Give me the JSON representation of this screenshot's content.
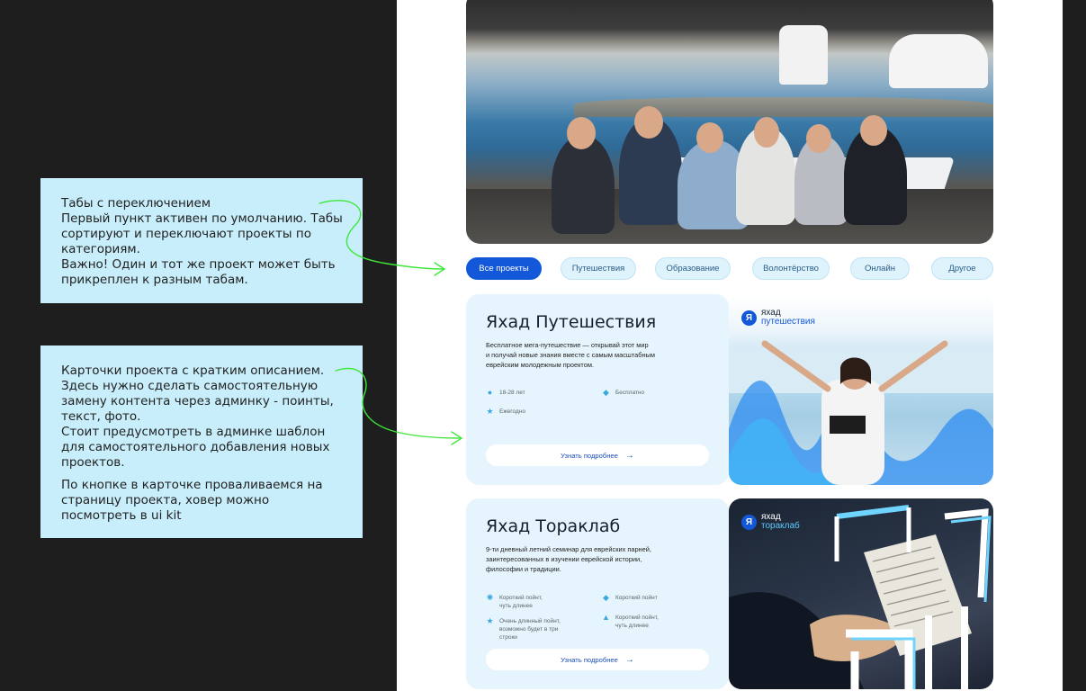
{
  "notes": [
    {
      "text": "Табы с переключением\nПервый пункт активен по умолчанию. Табы сортируют и переключают проекты по категориям.\nВажно! Один и тот же проект может быть прикреплен к разным табам."
    },
    {
      "text": "Карточки проекта с кратким описанием. Здесь нужно сделать самостоятельную замену контента через админку - поинты, текст, фото.\nСтоит предусмотреть в админке шаблон для самостоятельного добавления новых проектов.",
      "text2": "По кнопке в карточке проваливаемся на страницу проекта, ховер можно посмотреть в ui kit"
    }
  ],
  "tabs": [
    {
      "label": "Все проекты",
      "active": true
    },
    {
      "label": "Путешествия",
      "active": false
    },
    {
      "label": "Образование",
      "active": false
    },
    {
      "label": "Волонтёрство",
      "active": false
    },
    {
      "label": "Онлайн",
      "active": false
    },
    {
      "label": "Другое",
      "active": false
    }
  ],
  "cards": [
    {
      "title": "Яхад Путешествия",
      "description": "Бесплатное мега-путешествие — открывай этот мир\nи получай новые знания вместе с самым масштабным\nеврейским молодежным проектом.",
      "features": [
        {
          "icon": "person-icon",
          "text": "18-28 лет"
        },
        {
          "icon": "drop-icon",
          "text": "Бесплатно"
        },
        {
          "icon": "star-icon",
          "text": "Ежегодно"
        }
      ],
      "button": "Узнать подробнее",
      "brand": {
        "line1": "яхад",
        "line2": "путешествия",
        "mark": "Я"
      }
    },
    {
      "title": "Яхад Тораклаб",
      "description": "9-ти дневный летний семинар для еврейских парней,\nзаинтересованных в изучении еврейской истории,\nфилософии и традиции.",
      "features": [
        {
          "icon": "sun-icon",
          "text": "Короткий пойнт,\nчуть длинее"
        },
        {
          "icon": "drop-icon",
          "text": "Короткий пойнт"
        },
        {
          "icon": "star-icon",
          "text": "Очень длинный пойнт,\nвозможно будет в три\nстроки"
        },
        {
          "icon": "graduation-cap-icon",
          "text": "Короткий пойнт,\nчуть длинее"
        }
      ],
      "button": "Узнать подробнее",
      "brand": {
        "line1": "яхад",
        "line2": "тораклаб",
        "mark": "Я"
      }
    }
  ],
  "colors": {
    "accent": "#1358d8",
    "note_bg": "#c8eefb",
    "card_bg": "#e6f5fd",
    "arrow": "#3ee83a"
  }
}
